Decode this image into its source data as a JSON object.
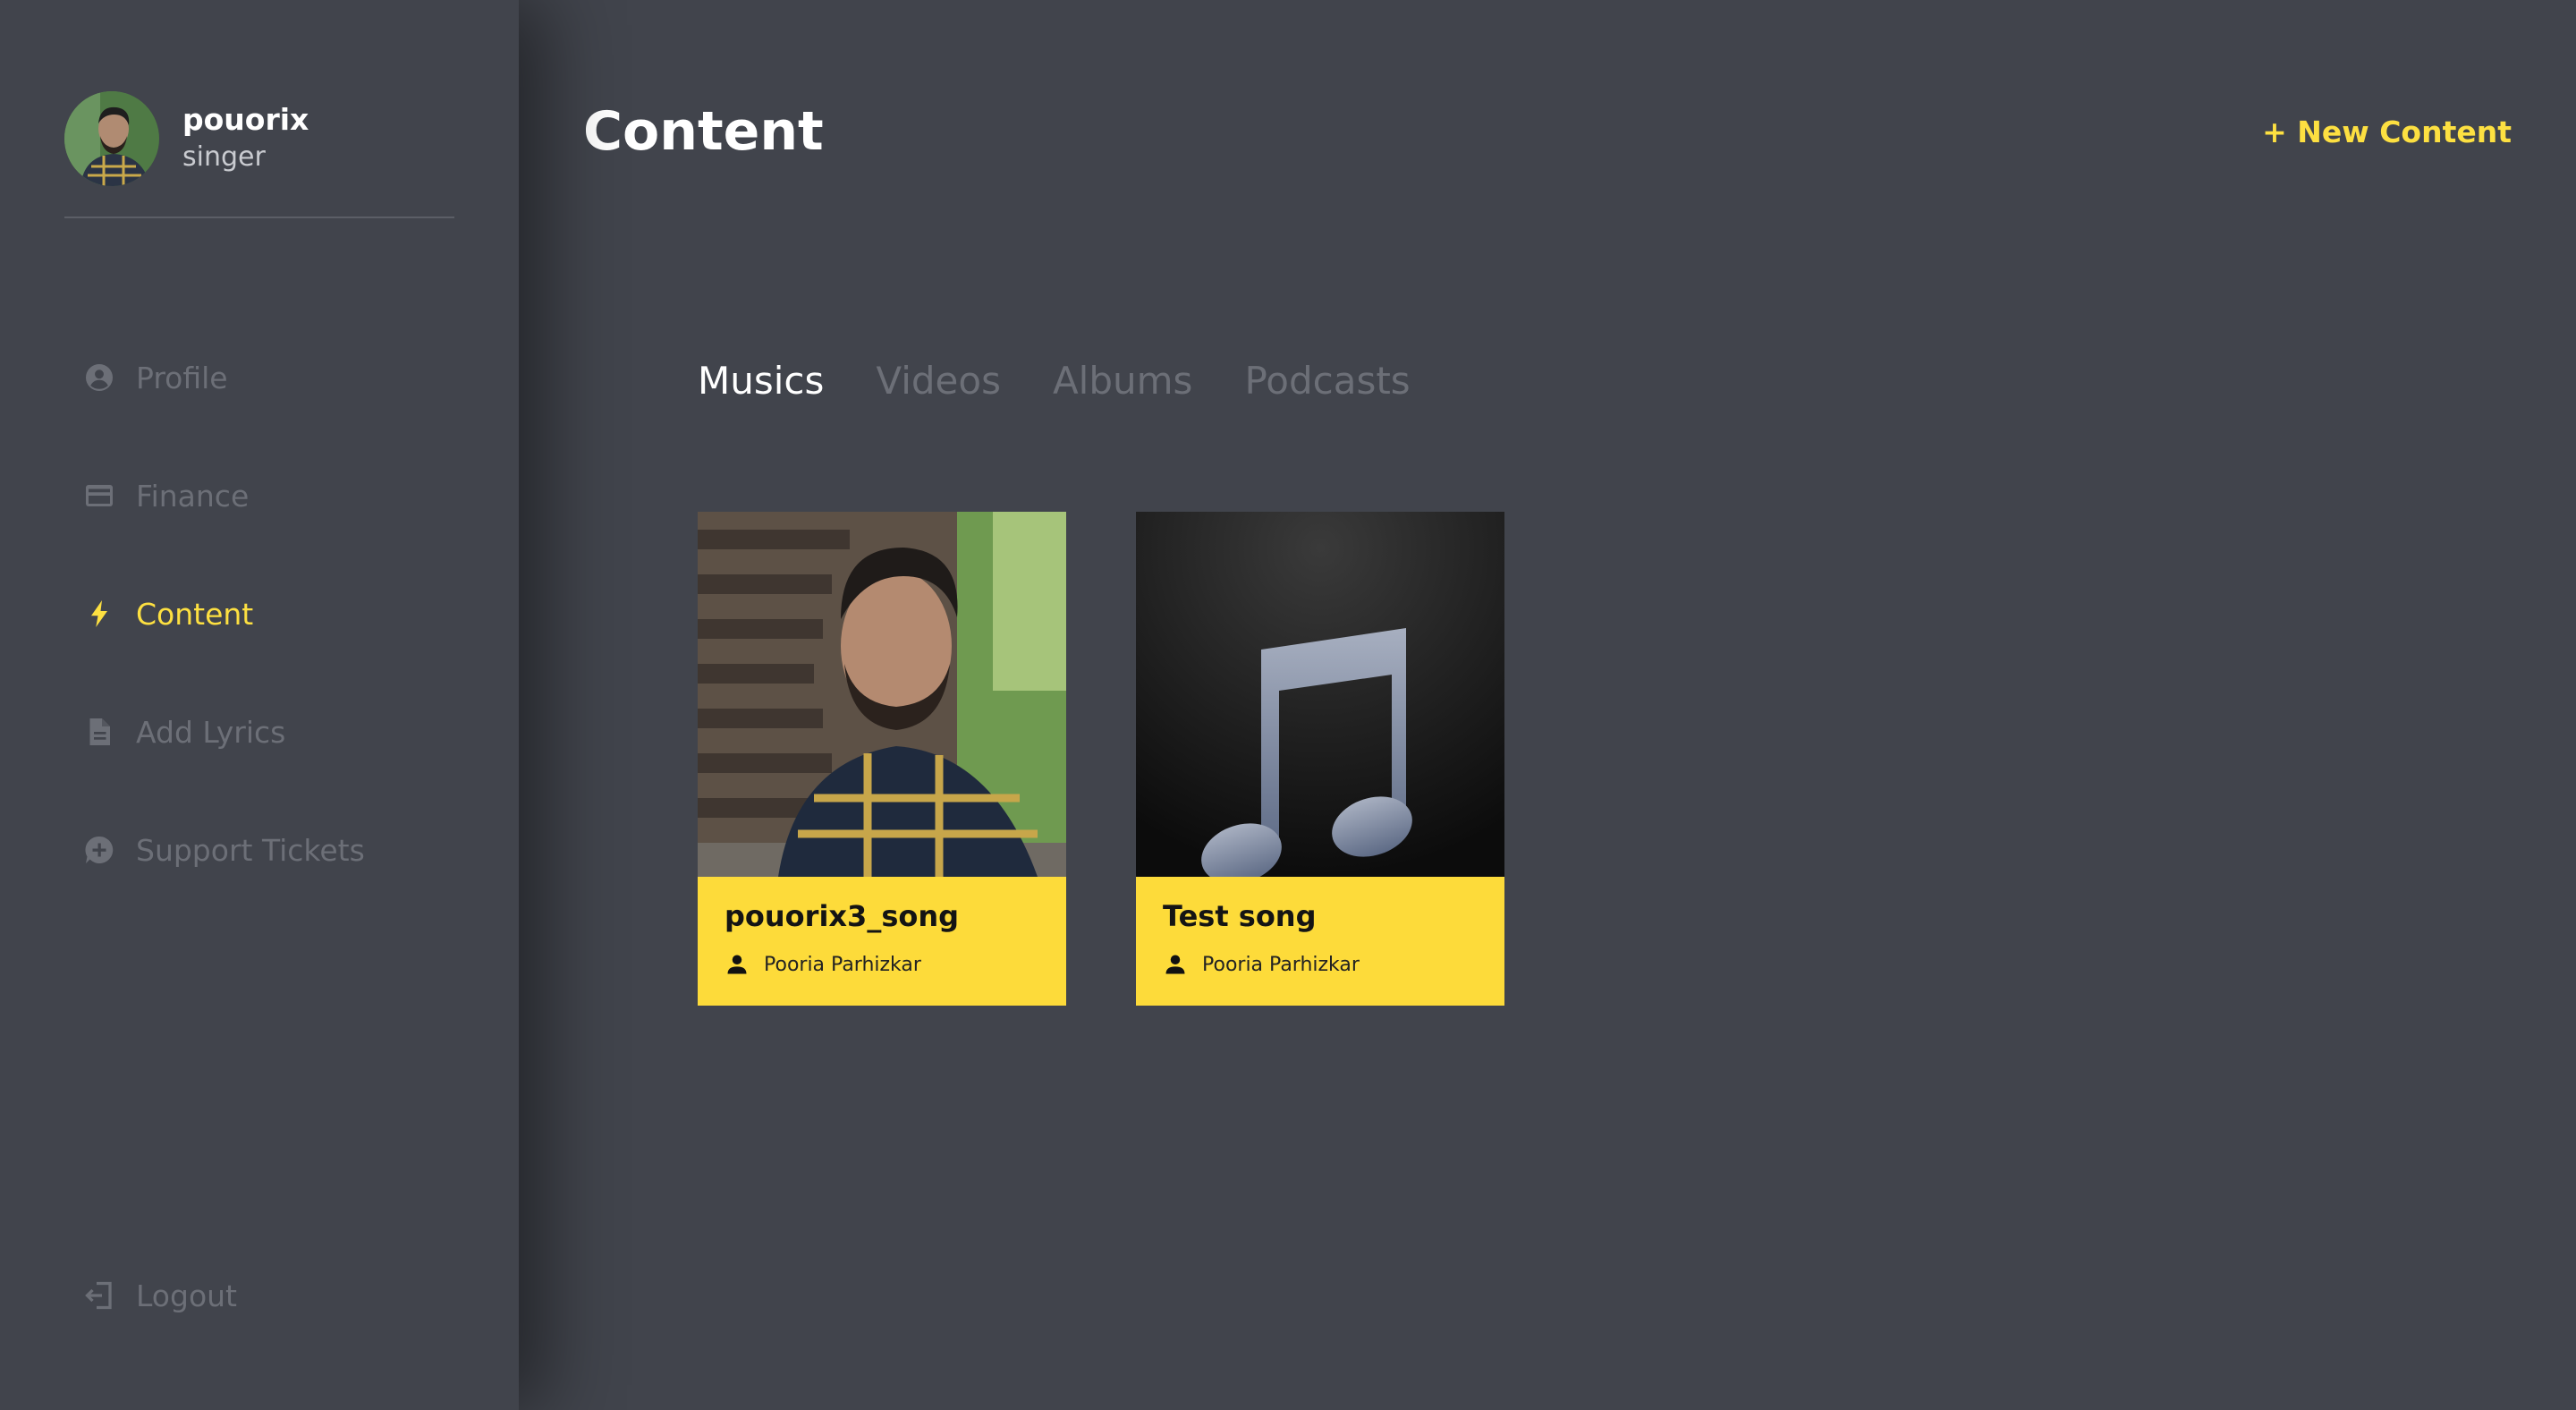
{
  "user": {
    "name": "pouorix",
    "role": "singer"
  },
  "sidebar": {
    "items": [
      {
        "label": "Profile",
        "icon": "account-circle-icon",
        "active": false
      },
      {
        "label": "Finance",
        "icon": "credit-card-icon",
        "active": false
      },
      {
        "label": "Content",
        "icon": "lightning-bolt-icon",
        "active": true
      },
      {
        "label": "Add Lyrics",
        "icon": "document-icon",
        "active": false
      },
      {
        "label": "Support Tickets",
        "icon": "chat-plus-icon",
        "active": false
      }
    ],
    "logout": {
      "label": "Logout",
      "icon": "logout-icon"
    }
  },
  "header": {
    "title": "Content",
    "new_button": "+ New Content"
  },
  "tabs": [
    {
      "label": "Musics",
      "active": true
    },
    {
      "label": "Videos",
      "active": false
    },
    {
      "label": "Albums",
      "active": false
    },
    {
      "label": "Podcasts",
      "active": false
    }
  ],
  "cards": [
    {
      "title": "pouorix3_song",
      "artist": "Pooria Parhizkar",
      "image": "artist-photo"
    },
    {
      "title": "Test song",
      "artist": "Pooria Parhizkar",
      "image": "music-note-placeholder"
    }
  ],
  "colors": {
    "accent": "#fde041",
    "card_footer": "#fddb3a",
    "background": "#41444c"
  }
}
